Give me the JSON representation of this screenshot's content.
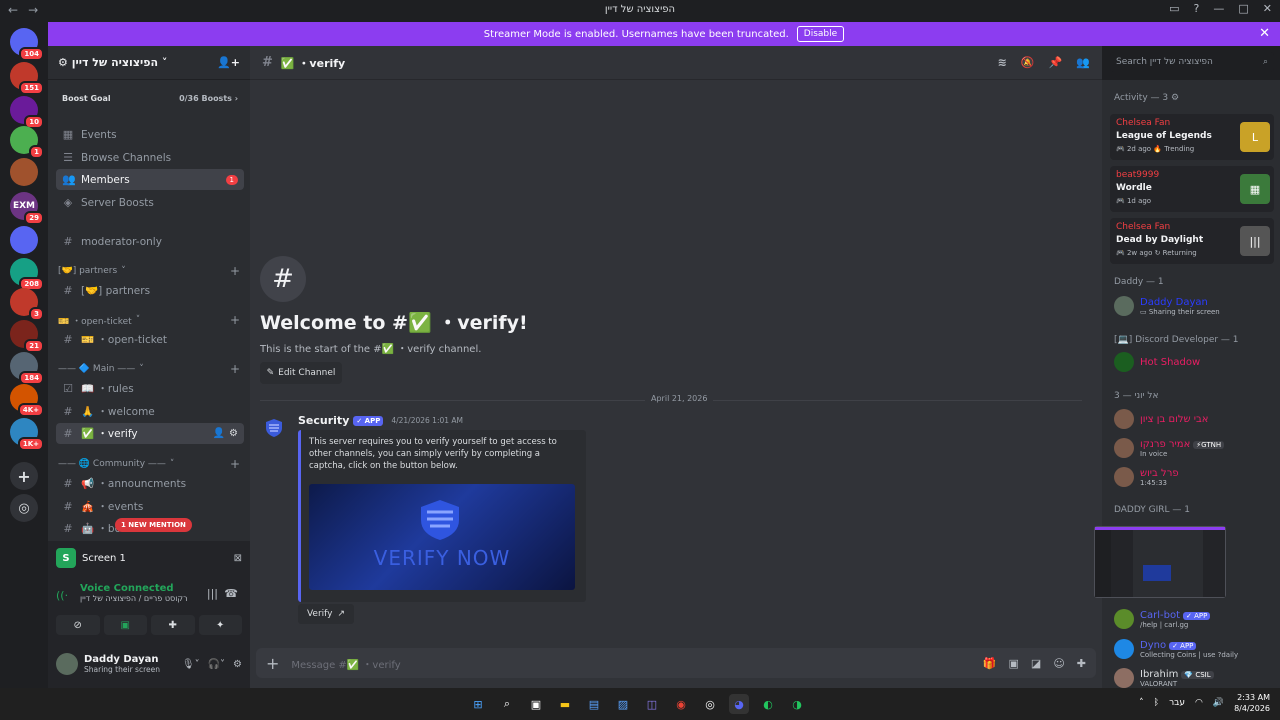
{
  "window": {
    "title": "הפיצוציה של דיין"
  },
  "banner": {
    "text": "Streamer Mode is enabled. Usernames have been truncated.",
    "disable": "Disable"
  },
  "servers": [
    {
      "badge": "104",
      "color": "#5865f2",
      "icon": "discord-home-icon"
    },
    {
      "badge": "151",
      "color": "#c0392b"
    },
    {
      "badge": "10",
      "color": "#6a1b9a"
    },
    {
      "badge": "1",
      "color": "#4caf50"
    },
    {
      "badge": "",
      "color": "#a0522d"
    },
    {
      "badge": "29",
      "color": "#6c3483",
      "label": "EXM"
    },
    {
      "badge": "",
      "color": "#5865f2"
    },
    {
      "badge": "208",
      "color": "#16a085"
    },
    {
      "badge": "3",
      "color": "#c0392b"
    },
    {
      "badge": "21",
      "color": "#7b241c"
    },
    {
      "badge": "184",
      "color": "#566573"
    },
    {
      "badge": "4K+",
      "color": "#d35400"
    },
    {
      "badge": "1K+",
      "color": "#2e86c1"
    }
  ],
  "sidebar": {
    "guild_name": "הפיצוציה של דיין",
    "boost_label": "Boost Goal",
    "boost_progress": "0/36 Boosts",
    "nav": [
      {
        "label": "Events",
        "icon": "calendar-icon"
      },
      {
        "label": "Browse Channels",
        "icon": "browse-icon"
      },
      {
        "label": "Members",
        "icon": "members-icon",
        "badge": "1"
      },
      {
        "label": "Server Boosts",
        "icon": "boost-icon"
      }
    ],
    "channels": {
      "moderator": "moderator-only",
      "cat_partners": "[🤝] partners",
      "partners": "[🤝] partners",
      "cat_ticket": "🎫 ・open-ticket",
      "ticket": "🎫 ・open-ticket",
      "cat_main": "—— 🔷 Main ——",
      "rules": "📖 ・rules",
      "welcome": "🙏 ・welcome",
      "verify": "✅ ・verify",
      "cat_community": "—— 🌐 Community ——",
      "announcements": "📢 ・announcments",
      "events": "🎪 ・events",
      "bot": "🤖 ・bo"
    },
    "new_mention": "1 NEW MENTION"
  },
  "voice": {
    "screen_label": "Screen 1",
    "connected": "Voice Connected",
    "channel_path": "רקוסט פריים / הפיצוציה של דיין",
    "user_name": "Daddy Dayan",
    "user_status": "Sharing their screen"
  },
  "channel": {
    "name": "✅ ・verify",
    "welcome_title": "Welcome to #✅ ・verify!",
    "welcome_sub": "This is the start of the #✅ ・verify channel.",
    "edit_channel": "Edit Channel",
    "date_divider": "April 21, 2026",
    "message": {
      "author": "Security",
      "app_tag": "✓ APP",
      "timestamp": "4/21/2026 1:01 AM",
      "description": "This server requires you to verify yourself to get access to other channels, you can simply verify by completing a captcha, click on the button below.",
      "image_text": "VERIFY NOW",
      "button": "Verify"
    },
    "composer_placeholder": "Message #✅ ・verify"
  },
  "search": {
    "placeholder": "Search הפיצוציה של דיין"
  },
  "activity": {
    "header": "Activity — 3",
    "items": [
      {
        "name": "Chelsea Fan",
        "game": "League of Legends",
        "meta": "🎮 2d ago  🔥 Trending",
        "color": "#c9a227",
        "icon": "L"
      },
      {
        "name": "beat9999",
        "game": "Wordle",
        "meta": "🎮 1d ago",
        "color": "#3b7a3b",
        "icon": "▦"
      },
      {
        "name": "Chelsea Fan",
        "game": "Dead by Daylight",
        "meta": "🎮 2w ago  ↻ Returning",
        "color": "#555",
        "icon": "|||"
      }
    ]
  },
  "members": {
    "daddy_header": "Daddy — 1",
    "daddy": {
      "name": "Daddy Dayan",
      "status": "Sharing their screen",
      "color": "#2b3cff"
    },
    "dev_header": "[💻] Discord Developer — 1",
    "dev": {
      "name": "Hot Shadow",
      "color": "#e91e63"
    },
    "friends_header": "אל יוני — 3",
    "friends": [
      {
        "name": "אבי שלום בן ציון",
        "status": "",
        "color": "#e91e63"
      },
      {
        "name": "אמיר פרנקו",
        "status": "In voice",
        "tag": "⚡GTNH",
        "color": "#e91e63"
      },
      {
        "name": "פרל ביוש",
        "status": "1:45:33",
        "color": "#e91e63"
      }
    ],
    "girl_header": "DADDY GIRL — 1",
    "bots": [
      {
        "name": "Carl-bot",
        "tag": "✓ APP",
        "status": "/help | carl.gg",
        "color": "#5865f2"
      },
      {
        "name": "Dyno",
        "tag": "✓ APP",
        "status": "Collecting Coins | use ?daily",
        "color": "#5865f2"
      },
      {
        "name": "Ibrahim",
        "tag": "💎 CSIL",
        "status": "VALORANT",
        "color": "#dbdee1"
      }
    ]
  },
  "taskbar": {
    "lang": "עבר",
    "time": "2:33 AM",
    "date": "8/4/2026"
  }
}
